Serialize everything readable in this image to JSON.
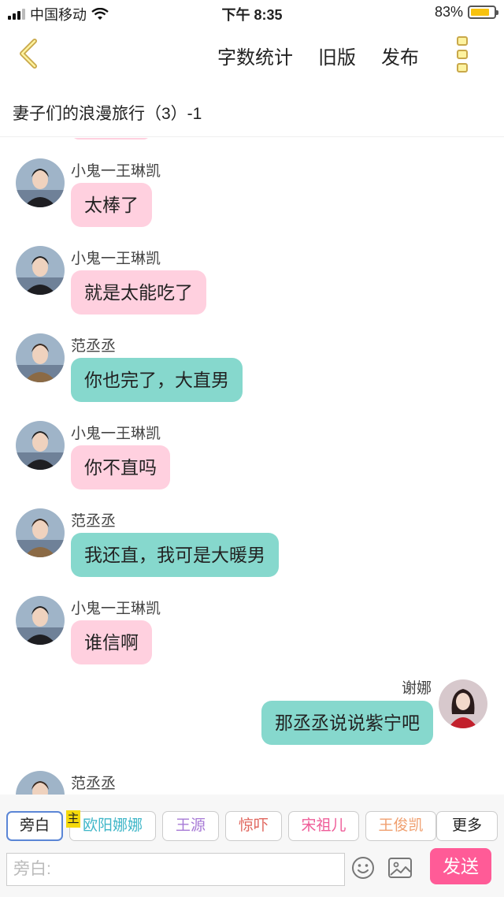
{
  "status_bar": {
    "carrier": "中国移动",
    "time": "下午 8:35",
    "battery": "83%",
    "battery_level": 0.83
  },
  "nav": {
    "back_icon": "chevron-left-icon",
    "word_count": "字数统计",
    "old_version": "旧版",
    "publish": "发布",
    "more_icon": "more-vertical-icon"
  },
  "title": "妻子们的浪漫旅行（3）-1",
  "messages": [
    {
      "name": "小鬼一王琳凯",
      "text": "太棒了",
      "side": "left",
      "color": "pink"
    },
    {
      "name": "小鬼一王琳凯",
      "text": "就是太能吃了",
      "side": "left",
      "color": "pink"
    },
    {
      "name": "范丞丞",
      "text": "你也完了，大直男",
      "side": "left",
      "color": "teal"
    },
    {
      "name": "小鬼一王琳凯",
      "text": "你不直吗",
      "side": "left",
      "color": "pink"
    },
    {
      "name": "范丞丞",
      "text": "我还直，我可是大暖男",
      "side": "left",
      "color": "teal"
    },
    {
      "name": "小鬼一王琳凯",
      "text": "谁信啊",
      "side": "left",
      "color": "pink"
    },
    {
      "name": "谢娜",
      "text": "那丞丞说说紫宁吧",
      "side": "right",
      "color": "teal"
    },
    {
      "name": "范丞丞",
      "text": "",
      "side": "left",
      "color": "teal"
    }
  ],
  "roles": {
    "narration": "旁白",
    "host_badge": "主",
    "items": [
      {
        "label": "欧阳娜娜",
        "color": "#3fb6c8"
      },
      {
        "label": "王源",
        "color": "#a77ad6"
      },
      {
        "label": "惊吓",
        "color": "#e0655d"
      },
      {
        "label": "宋祖儿",
        "color": "#ef5d99"
      },
      {
        "label": "王俊凯",
        "color": "#f0a070"
      }
    ],
    "more": "更多"
  },
  "input": {
    "placeholder": "旁白:",
    "emoji_icon": "smiley-icon",
    "image_icon": "image-icon",
    "send": "发送"
  },
  "colors": {
    "pink_bubble": "#ffd0df",
    "teal_bubble": "#86d8cd",
    "send_button": "#ff5b97",
    "accent_yellow": "#f7c20f"
  }
}
